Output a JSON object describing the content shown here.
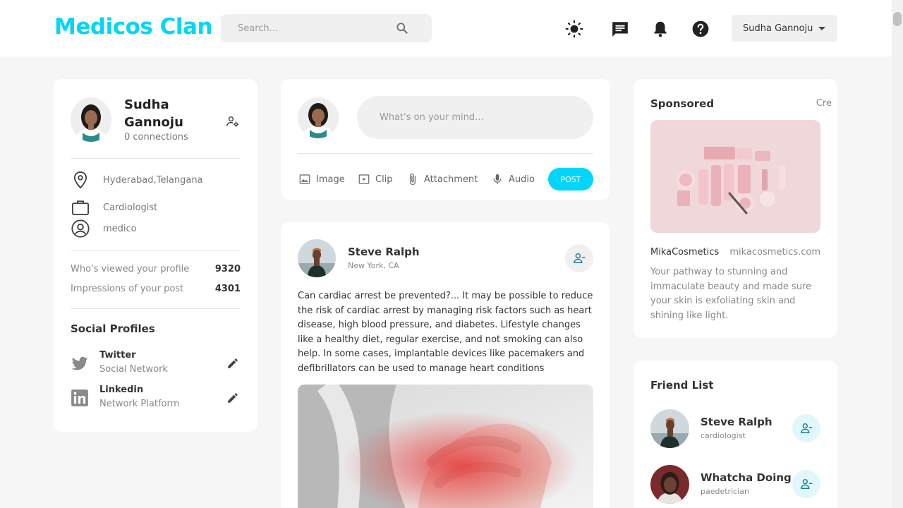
{
  "app": {
    "logo": "Medicos Clan"
  },
  "search": {
    "placeholder": "Search..."
  },
  "nav": {
    "icons": [
      "sun-icon",
      "message-icon",
      "bell-icon",
      "help-icon"
    ],
    "user_name": "Sudha Gannoju"
  },
  "colors": {
    "accent": "#00d5fa",
    "background": "#f6f6f6",
    "card": "#ffffff"
  },
  "profile": {
    "name": "Sudha Gannoju",
    "connections": "0 connections",
    "location": "Hyderabad,Telangana",
    "occupation": "Cardiologist",
    "role": "medico",
    "stats": [
      {
        "label": "Who's viewed your profile",
        "value": "9320"
      },
      {
        "label": "Impressions of your post",
        "value": "4301"
      }
    ],
    "social_title": "Social Profiles",
    "socials": [
      {
        "name": "Twitter",
        "sub": "Social Network",
        "icon": "twitter-icon"
      },
      {
        "name": "Linkedin",
        "sub": "Network Platform",
        "icon": "linkedin-icon"
      }
    ]
  },
  "composer": {
    "placeholder": "What's on your mind...",
    "actions": [
      {
        "label": "Image",
        "icon": "image-icon"
      },
      {
        "label": "Clip",
        "icon": "clip-icon"
      },
      {
        "label": "Attachment",
        "icon": "attachment-icon"
      },
      {
        "label": "Audio",
        "icon": "microphone-icon"
      }
    ],
    "post_label": "POST"
  },
  "post": {
    "author": "Steve Ralph",
    "location": "New York, CA",
    "text": "Can cardiac arrest be prevented?... It may be possible to reduce the risk of cardiac arrest by managing risk factors such as heart disease, high blood pressure, and diabetes. Lifestyle changes like a healthy diet, regular exercise, and not smoking can also help. In some cases, implantable devices like pacemakers and defibrillators can be used to manage heart conditions"
  },
  "sponsored": {
    "title": "Sponsored",
    "create_label": "Cre",
    "brand": "MikaCosmetics",
    "url": "mikacosmetics.com",
    "description": "Your pathway to stunning and immaculate beauty and made sure your skin is exfoliating skin and shining like light."
  },
  "friends": {
    "title": "Friend List",
    "items": [
      {
        "name": "Steve Ralph",
        "role": "cardiologist"
      },
      {
        "name": "Whatcha Doing",
        "role": "paedetrician"
      }
    ]
  }
}
